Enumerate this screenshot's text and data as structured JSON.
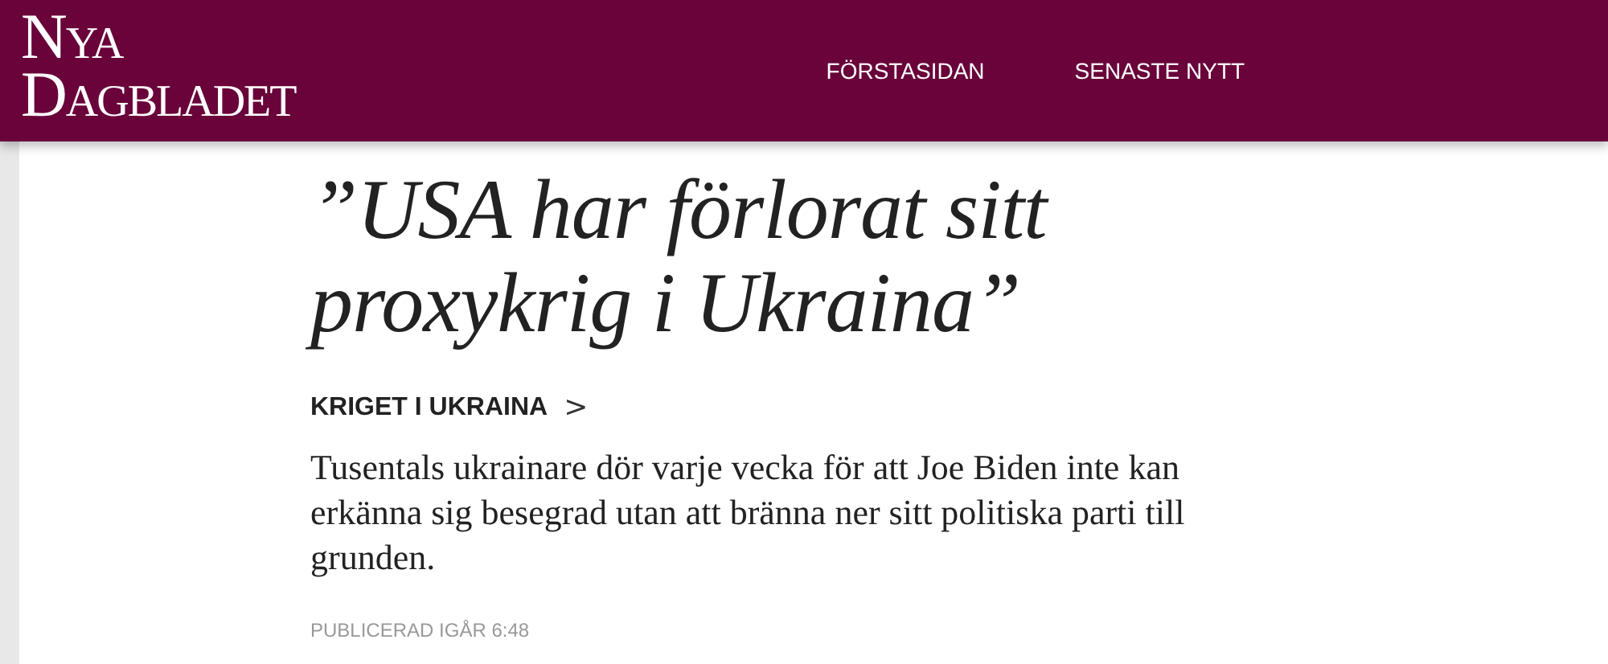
{
  "header": {
    "logo": [
      "Nya",
      "Dagbladet"
    ],
    "nav": [
      {
        "label": "FÖRSTASIDAN"
      },
      {
        "label": "SENASTE NYTT"
      }
    ]
  },
  "article": {
    "headline": "”USA har förlorat sitt proxykrig i Ukraina”",
    "category": "KRIGET I UKRAINA",
    "category_arrow": ">",
    "lead": "Tusentals ukrainare dör varje vecka för att Joe Biden inte kan erkänna sig besegrad utan att bränna ner sitt politiska parti till grunden.",
    "published": "PUBLICERAD IGÅR 6:48"
  }
}
